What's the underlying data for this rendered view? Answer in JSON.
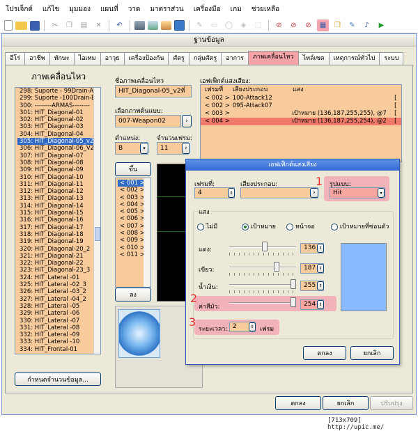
{
  "menu": [
    "โปรเจ็กต์",
    "แก้ไข",
    "มุมมอง",
    "แผนที่",
    "วาด",
    "มาตราส่วน",
    "เครื่องมือ",
    "เกม",
    "ช่วยเหลือ"
  ],
  "database_window": {
    "title": "ฐานข้อมูล",
    "tabs": [
      "อีโร่",
      "อาชีพ",
      "ทักษะ",
      "ไอเทม",
      "อาวุธ",
      "เครื่องป้องกัน",
      "ศัตรู",
      "กลุ่มศัตรู",
      "อาการ",
      "ภาพเคลื่อนไหว",
      "ไทล์เซต",
      "เหตุการณ์ทั่วไป",
      "ระบบ"
    ],
    "active_tab": "ภาพเคลื่อนไหว",
    "list_title": "ภาพเคลื่อนไหว",
    "list_items": [
      "298: Suporte - 99Drain-A",
      "299: Suporte -100Drain-B",
      "300: --------ARMAS--------",
      "301: HIT_Diagonal-01",
      "302: HIT_Diagonal-02",
      "303: HIT_Diagonal-03",
      "304: HIT_Diagonal-04",
      "305: HIT_Diagonal-05_v2ที",
      "306: HIT_Diagonal-06_V2ที",
      "307: HIT_Diagonal-07",
      "308: HIT_Diagonal-08",
      "309: HIT_Diagonal-09",
      "310: HIT_Diagonal-10",
      "311: HIT_Diagonal-11",
      "312: HIT_Diagonal-12",
      "313: HIT_Diagonal-13",
      "314: HIT_Diagonal-14",
      "315: HIT_Diagonal-15",
      "316: HIT_Diagonal-16",
      "317: HIT_Diagonal-17",
      "318: HIT_Diagonal-18",
      "319: HIT_Diagonal-19",
      "320: HIT_Diagonal-20_2",
      "321: HIT_Diagonal-21",
      "322: HIT_Diagonal-22",
      "323: HIT_Diagonal-23_3",
      "324: HIT_Lateral -01",
      "325: HIT_Lateral -02_3",
      "326: HIT_Lateral -03_2",
      "327: HIT_Lateral -04_2",
      "328: HIT_Lateral -05",
      "329: HIT_Lateral -06",
      "330: HIT_Lateral -07",
      "331: HIT_Lateral -08",
      "332: HIT_Lateral -09",
      "333: HIT_Lateral -10",
      "334: HIT_Frontal-01"
    ],
    "selected_index": 7,
    "set_count_button": "กำหนดจำนวนข้อมูล...",
    "name_label": "ชื่อภาพเคลื่อนไหว",
    "name_value": "HIT_Diagonal-05_v2ที่",
    "base_image_label": "เลือกภาพต้นแบบ:",
    "base_image_value": "007-Weapon02",
    "position_label": "ตำแหน่ง:",
    "position_value": "B",
    "frames_label": "จำนวนเฟรม:",
    "frames_value": "11",
    "up_button": "ขึ้น",
    "down_button": "ลง",
    "frame_list": [
      "< 001 >",
      "< 002 >",
      "< 003 >",
      "< 004 >",
      "< 005 >",
      "< 006 >",
      "< 007 >",
      "< 008 >",
      "< 009 >",
      "< 010 >",
      "< 011 >"
    ],
    "se_title": "เอฟเฟ็กต์แสงเสียง:",
    "se_headers": [
      "เฟรมที่",
      "เสียงประกอบ",
      "แสง"
    ],
    "se_rows": [
      {
        "frame": "< 002 >",
        "sound": "100-Attack12",
        "flash": "",
        "end": "["
      },
      {
        "frame": "< 002 >",
        "sound": "095-Attack07",
        "flash": "",
        "end": "["
      },
      {
        "frame": "< 003 >",
        "sound": "",
        "flash": "เป้าหมาย (136,187,255,255), @7",
        "end": "["
      },
      {
        "frame": "< 004 >",
        "sound": "",
        "flash": "เป้าหมาย (136,187,255,254), @2",
        "end": "["
      }
    ],
    "ok": "ตกลง",
    "cancel": "ยกเลิก",
    "apply": "ปรับปรุง"
  },
  "dialog": {
    "title": "เอฟเฟ็กต์แสงเสียง",
    "frame_label": "เฟรมที่:",
    "frame_value": "4",
    "sound_label": "เสียงประกอบ:",
    "condition_label": "รูปแบบ:",
    "condition_value": "Hit",
    "flash_group": "แสง",
    "radios": [
      "ไม่มี",
      "เป้าหมาย",
      "หน้าจอ",
      "เป้าหมายที่ซ่อนตัว"
    ],
    "radio_selected": 1,
    "red_label": "แดง:",
    "red_value": "136",
    "red_level": 0.53,
    "green_label": "เขียว:",
    "green_value": "187",
    "green_level": 0.73,
    "blue_label": "น้ำเงิน:",
    "blue_value": "255",
    "blue_level": 1.0,
    "strength_label": "ค่าสีมัว:",
    "strength_value": "254",
    "strength_level": 0.996,
    "duration_label": "ระยะเวลา:",
    "duration_value": "2",
    "duration_unit": "เฟรม",
    "flash_color": "#88bbff",
    "ok": "ตกลง",
    "cancel": "ยกเลิก",
    "marker1": "1",
    "marker2": "2",
    "marker3": "3"
  },
  "watermark": "[713x709] http://upic.me/"
}
